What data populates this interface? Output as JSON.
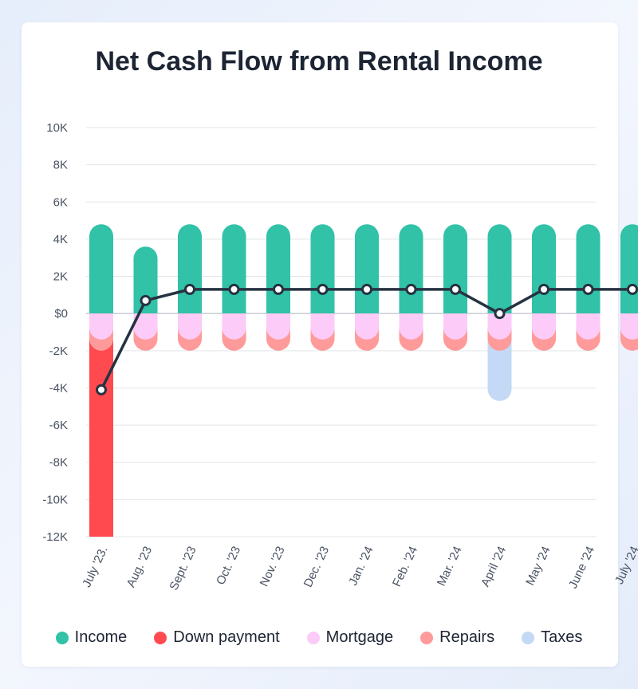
{
  "chart_data": {
    "type": "bar",
    "title": "Net Cash Flow from Rental Income",
    "categories": [
      "July '23.",
      "Aug. '23",
      "Sept. '23",
      "Oct. '23",
      "Nov. '23",
      "Dec. '23",
      "Jan. '24",
      "Feb. '24",
      "Mar. '24",
      "April '24",
      "May '24",
      "June '24",
      "July '24"
    ],
    "ylim": [
      -12000,
      10000
    ],
    "yticks": [
      10000,
      8000,
      6000,
      4000,
      2000,
      0,
      -2000,
      -4000,
      -6000,
      -8000,
      -10000,
      -12000
    ],
    "ytick_labels": [
      "10K",
      "8K",
      "6K",
      "4K",
      "2K",
      "$0",
      "-2K",
      "-4K",
      "-6K",
      "-8K",
      "-10K",
      "-12K"
    ],
    "grid": true,
    "stacked": true,
    "legend_position": "bottom",
    "series": [
      {
        "name": "Income",
        "color": "#31c2a8",
        "values": [
          4800,
          3600,
          4800,
          4800,
          4800,
          4800,
          4800,
          4800,
          4800,
          4800,
          4800,
          4800,
          4800
        ]
      },
      {
        "name": "Down payment",
        "color": "#ff4a50",
        "values": [
          -10000,
          0,
          0,
          0,
          0,
          0,
          0,
          0,
          0,
          0,
          0,
          0,
          0
        ]
      },
      {
        "name": "Mortgage",
        "color": "#fccbf8",
        "values": [
          -1400,
          -1400,
          -1400,
          -1400,
          -1400,
          -1400,
          -1400,
          -1400,
          -1400,
          -1400,
          -1400,
          -1400,
          -1400
        ]
      },
      {
        "name": "Repairs",
        "color": "#ff9a9a",
        "values": [
          -600,
          -600,
          -600,
          -600,
          -600,
          -600,
          -600,
          -600,
          -600,
          -600,
          -600,
          -600,
          -600
        ]
      },
      {
        "name": "Taxes",
        "color": "#c3d9f5",
        "values": [
          0,
          0,
          0,
          0,
          0,
          0,
          0,
          0,
          0,
          -2700,
          0,
          0,
          0
        ]
      }
    ],
    "line": {
      "type": "line",
      "color": "#263241",
      "values": [
        -4100,
        700,
        1300,
        1300,
        1300,
        1300,
        1300,
        1300,
        1300,
        0,
        1300,
        1300,
        1300
      ]
    }
  }
}
